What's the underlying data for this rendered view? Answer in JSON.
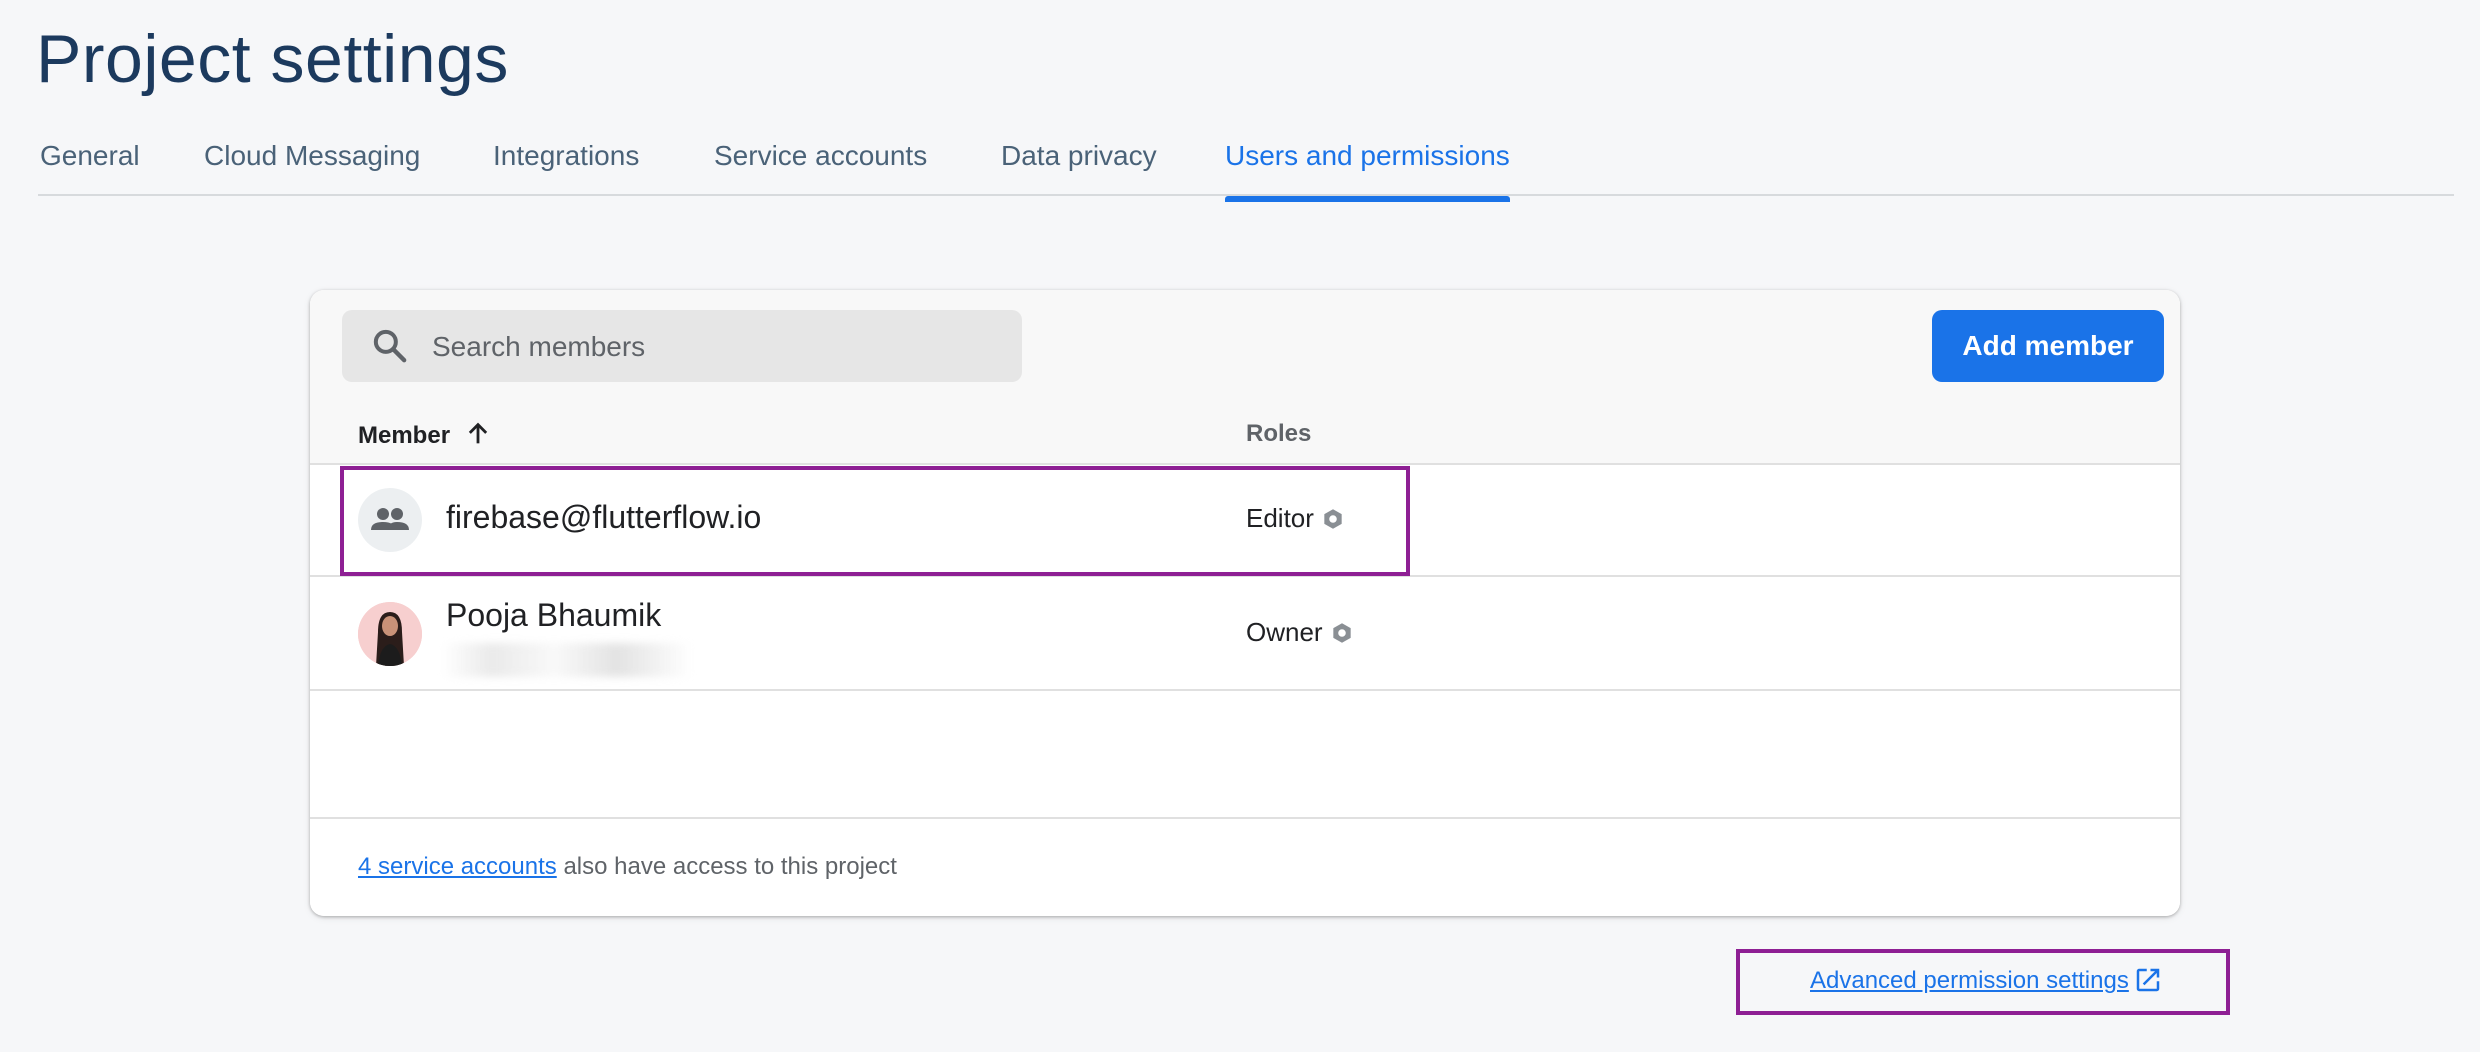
{
  "page": {
    "title": "Project settings"
  },
  "tabs": [
    {
      "label": "General",
      "active": false
    },
    {
      "label": "Cloud Messaging",
      "active": false
    },
    {
      "label": "Integrations",
      "active": false
    },
    {
      "label": "Service accounts",
      "active": false
    },
    {
      "label": "Data privacy",
      "active": false
    },
    {
      "label": "Users and permissions",
      "active": true
    }
  ],
  "search": {
    "placeholder": "Search members",
    "icon": "search-icon"
  },
  "toolbar": {
    "add_member_label": "Add member"
  },
  "table": {
    "columns": {
      "member": "Member",
      "roles": "Roles"
    },
    "sort_icon": "arrow-up-icon",
    "rows": [
      {
        "name": "firebase@flutterflow.io",
        "role": "Editor",
        "avatar": "group-icon"
      },
      {
        "name": "Pooja Bhaumik",
        "role": "Owner",
        "avatar": "user-photo"
      }
    ]
  },
  "footer": {
    "link": "4 service accounts",
    "text": "also have access to this project"
  },
  "advanced": {
    "label": "Advanced permission settings",
    "icon": "external-link-icon"
  },
  "colors": {
    "accent": "#1a73e8",
    "title": "#1c3a5e",
    "highlight": "#8e1f94"
  }
}
